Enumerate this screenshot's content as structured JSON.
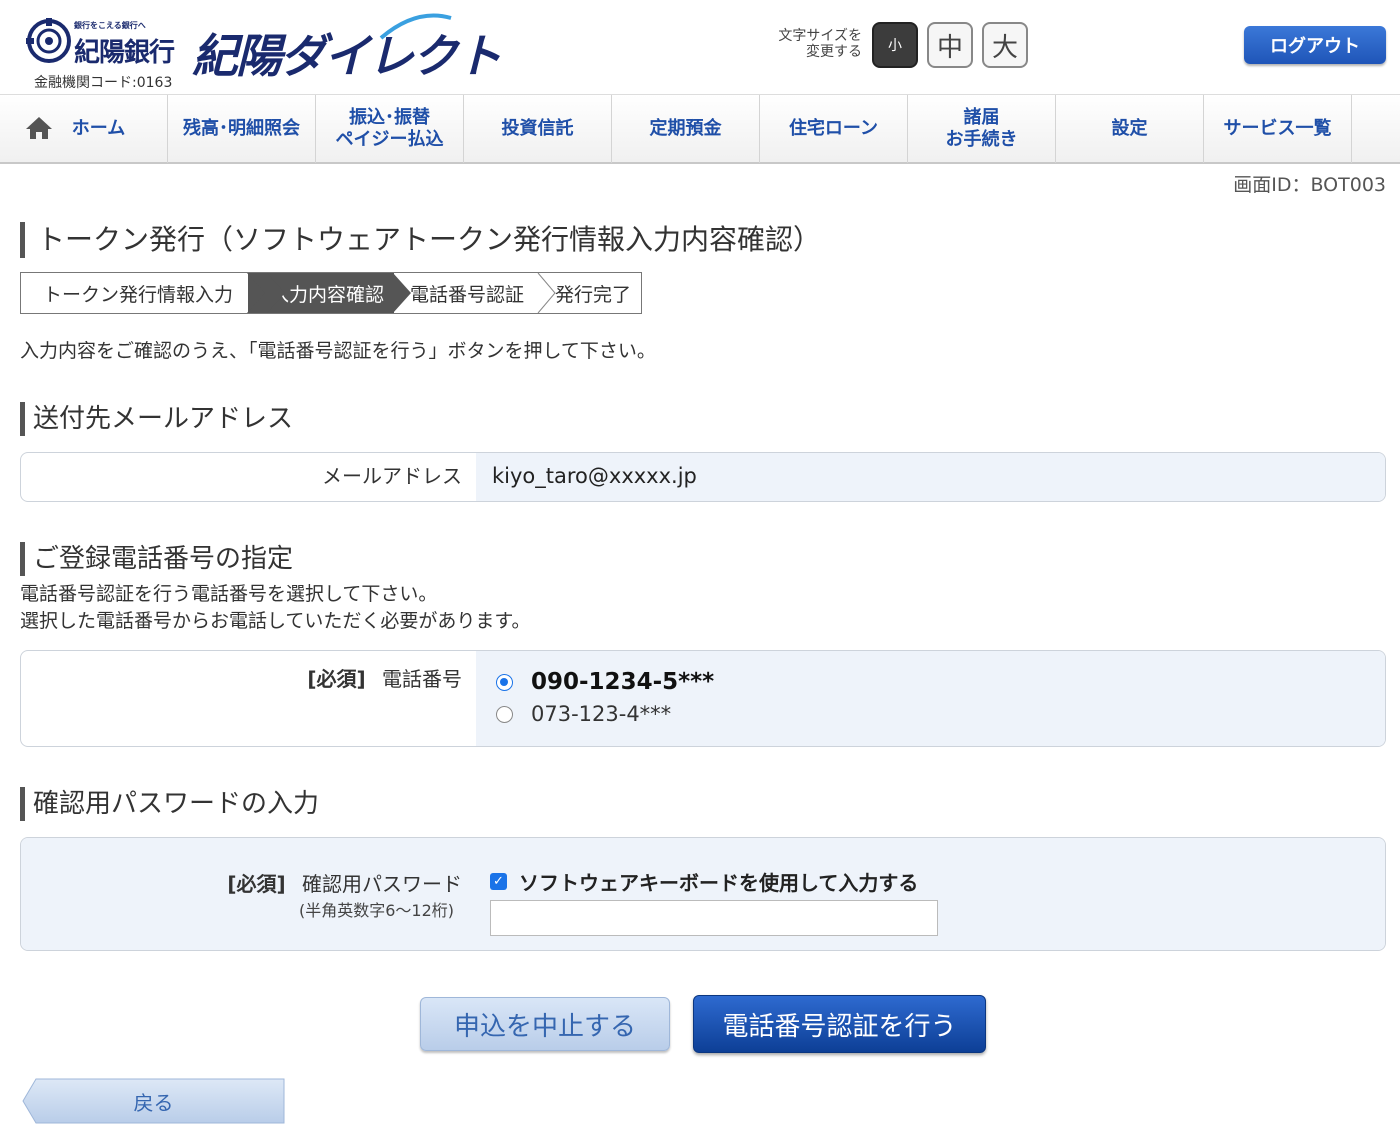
{
  "header": {
    "bank_tagline": "銀行をこえる銀行へ",
    "bank_name": "紀陽銀行",
    "brand": "紀陽ダイレクト",
    "bank_code": "金融機関コード:0163",
    "fontsize_label_line1": "文字サイズを",
    "fontsize_label_line2": "変更する",
    "fontsize_small": "小",
    "fontsize_medium": "中",
    "fontsize_large": "大",
    "logout": "ログアウト"
  },
  "nav": {
    "items": [
      {
        "label": "ホーム"
      },
      {
        "label": "残高･明細照会"
      },
      {
        "label_line1": "振込･振替",
        "label_line2": "ペイジー払込"
      },
      {
        "label": "投資信託"
      },
      {
        "label": "定期預金"
      },
      {
        "label": "住宅ローン"
      },
      {
        "label_line1": "諸届",
        "label_line2": "お手続き"
      },
      {
        "label": "設定"
      },
      {
        "label": "サービス一覧"
      }
    ]
  },
  "screen_id": "画面ID：BOT003",
  "page_title": "トークン発行（ソフトウェアトークン発行情報入力内容確認）",
  "steps": [
    "トークン発行情報入力",
    "入力内容確認",
    "電話番号認証",
    "発行完了"
  ],
  "instruction": "入力内容をご確認のうえ、「電話番号認証を行う」ボタンを押して下さい。",
  "email_section": {
    "title": "送付先メールアドレス",
    "label": "メールアドレス",
    "value": "kiyo_taro@xxxxx.jp"
  },
  "phone_section": {
    "title": "ご登録電話番号の指定",
    "desc_line1": "電話番号認証を行う電話番号を選択して下さい。",
    "desc_line2": "選択した電話番号からお電話していただく必要があります。",
    "required": "[必須]",
    "label": "電話番号",
    "options": [
      "090-1234-5***",
      "073-123-4***"
    ],
    "selected_index": 0
  },
  "password_section": {
    "title": "確認用パスワードの入力",
    "required": "[必須]",
    "label": "確認用パスワード",
    "hint": "(半角英数字6～12桁)",
    "checkbox_label": "ソフトウェアキーボードを使用して入力する",
    "checkbox_checked": true,
    "input_value": ""
  },
  "buttons": {
    "cancel": "申込を中止する",
    "submit": "電話番号認証を行う",
    "back": "戻る"
  },
  "colors": {
    "brand_navy": "#1a2a6e",
    "nav_text": "#1f4fa8",
    "primary_button": "#1f55b8",
    "form_value_bg": "#eef3fa"
  }
}
